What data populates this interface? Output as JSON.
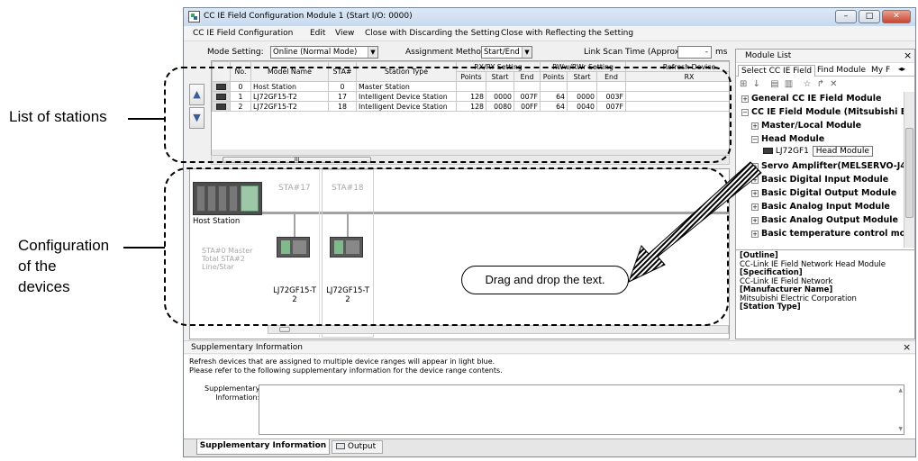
{
  "annotations": {
    "list_of_stations": "List of stations",
    "configuration": [
      "Configuration",
      "of the",
      "devices"
    ],
    "drag_drop": "Drag and drop the text."
  },
  "window": {
    "title": "CC IE Field Configuration Module 1 (Start I/O: 0000)",
    "minimize": "–",
    "maximize": "□",
    "close": "✕"
  },
  "menu": [
    "CC IE Field Configuration",
    "Edit",
    "View",
    "Close with Discarding the Setting",
    "Close with Reflecting the Setting"
  ],
  "settings": {
    "mode_label": "Mode Setting:",
    "mode_value": "Online (Normal Mode)",
    "assign_label": "Assignment Method:",
    "assign_value": "Start/End",
    "scan_label": "Link Scan Time (Approx.):",
    "scan_value": "-",
    "scan_unit": "ms"
  },
  "table": {
    "headers": {
      "no": "No.",
      "model": "Model Name",
      "sta": "STA#",
      "type": "Station Type",
      "rxry": "RX/RY Setting",
      "rwwrwr": "RWw/RWr Setting",
      "refresh": "Refresh Device",
      "points": "Points",
      "start": "Start",
      "end": "End",
      "rx": "RX"
    },
    "rows": [
      {
        "no": "0",
        "model": "Host Station",
        "sta": "0",
        "type": "Master Station",
        "rx_points": "",
        "rx_start": "",
        "rx_end": "",
        "rw_points": "",
        "rw_start": "",
        "rw_end": ""
      },
      {
        "no": "1",
        "model": "LJ72GF15-T2",
        "sta": "17",
        "type": "Intelligent Device Station",
        "rx_points": "128",
        "rx_start": "0000",
        "rx_end": "007F",
        "rw_points": "64",
        "rw_start": "0000",
        "rw_end": "003F"
      },
      {
        "no": "2",
        "model": "LJ72GF15-T2",
        "sta": "18",
        "type": "Intelligent Device Station",
        "rx_points": "128",
        "rx_start": "0080",
        "rx_end": "00FF",
        "rw_points": "64",
        "rw_start": "0040",
        "rw_end": "007F"
      }
    ]
  },
  "map": {
    "sta17": "STA#17",
    "sta18": "STA#18",
    "host_label": "Host Station",
    "host_info": [
      "STA#0  Master",
      "Total STA#2",
      "Line/Star"
    ],
    "dev1_model": [
      "LJ72GF15-T",
      "2"
    ],
    "dev2_model": [
      "LJ72GF15-T",
      "2"
    ],
    "scroll_glyph": "III"
  },
  "module_list": {
    "title": "Module List",
    "close": "×",
    "tabs": [
      "Select CC IE Field",
      "Find Module",
      "My F"
    ],
    "tree": [
      {
        "sign": "+",
        "label": "General CC IE Field Module",
        "indent": 0
      },
      {
        "sign": "−",
        "label": "CC IE Field Module (Mitsubishi Elec",
        "indent": 0
      },
      {
        "sign": "+",
        "label": "Master/Local Module",
        "indent": 1
      },
      {
        "sign": "−",
        "label": "Head Module",
        "indent": 1
      },
      {
        "sign": "+",
        "label": "Servo Amplifter(MELSERVO-J4 S",
        "indent": 1
      },
      {
        "sign": "+",
        "label": "Basic Digital Input Module",
        "indent": 1
      },
      {
        "sign": "+",
        "label": "Basic Digital Output Module",
        "indent": 1
      },
      {
        "sign": "+",
        "label": "Basic Analog Input Module",
        "indent": 1
      },
      {
        "sign": "+",
        "label": "Basic Analog Output Module",
        "indent": 1
      },
      {
        "sign": "+",
        "label": "Basic temperature control modu",
        "indent": 1
      }
    ],
    "leaf_model": "LJ72GF1",
    "leaf_tooltip": "Head Module",
    "info": [
      {
        "text": "[Outline]",
        "bold": true
      },
      {
        "text": "CC-Link IE Field Network Head Module",
        "bold": false
      },
      {
        "text": "[Specification]",
        "bold": true
      },
      {
        "text": "CC-Link IE Field Network",
        "bold": false
      },
      {
        "text": "[Manufacturer Name]",
        "bold": true
      },
      {
        "text": "Mitsubishi Electric Corporation",
        "bold": false
      },
      {
        "text": "[Station Type]",
        "bold": true
      }
    ]
  },
  "supplementary": {
    "title": "Supplementary Information",
    "close": "×",
    "line1": "Refresh devices that are assigned to multiple device ranges will appear in light blue.",
    "line2": "Please refer to the following supplementary information for the device range contents.",
    "field_label": [
      "Supplementary",
      "Information:"
    ],
    "tab_active": "Supplementary Information",
    "tab_output": "Output"
  }
}
